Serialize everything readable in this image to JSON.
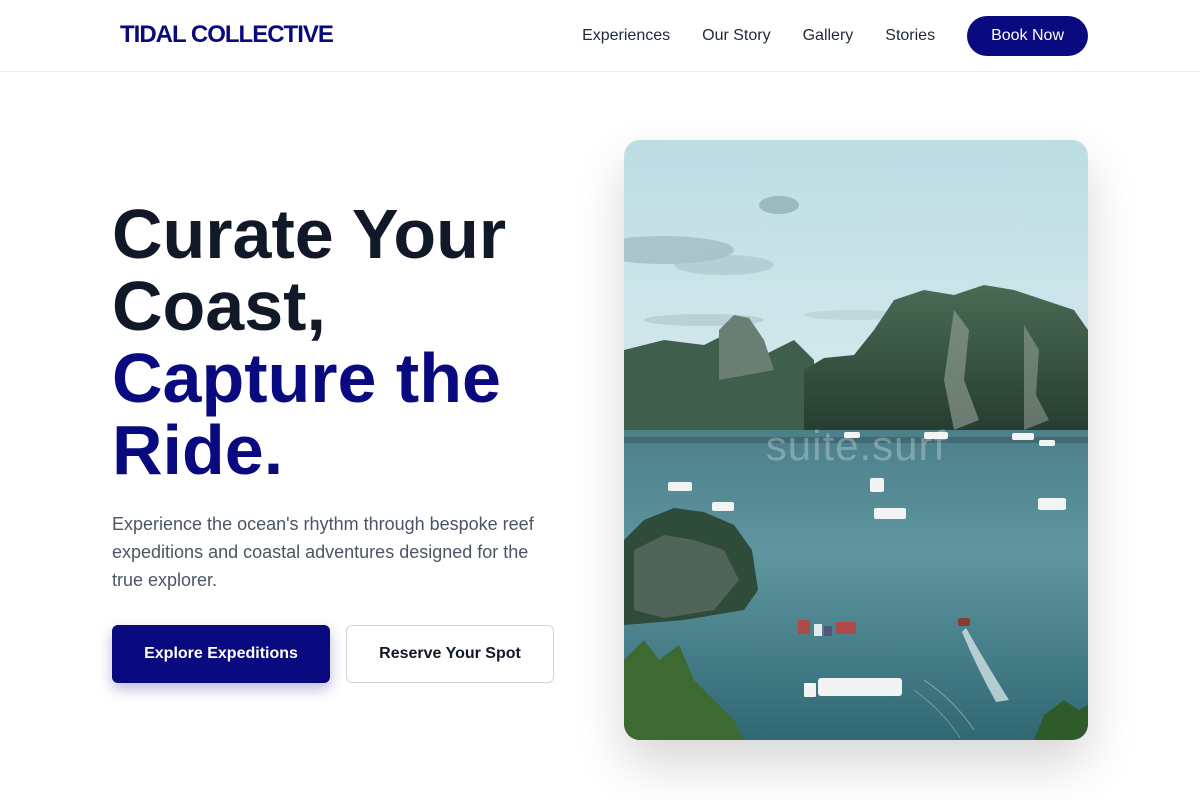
{
  "brand": {
    "name": "TIDAL COLLECTIVE"
  },
  "nav": {
    "links": [
      "Experiences",
      "Our Story",
      "Gallery",
      "Stories"
    ],
    "cta": "Book Now"
  },
  "hero": {
    "title_line1": "Curate Your",
    "title_line2": "Coast,",
    "title_line3": "Capture the",
    "title_line4": "Ride.",
    "description": "Experience the ocean's rhythm through bespoke reef expeditions and coastal adventures designed for the true explorer.",
    "primary_button": "Explore Expeditions",
    "secondary_button": "Reserve Your Spot",
    "image_watermark": "suite.surf"
  },
  "colors": {
    "brand": "#0a0a80",
    "heading": "#111827",
    "body_text": "#4b5563"
  }
}
